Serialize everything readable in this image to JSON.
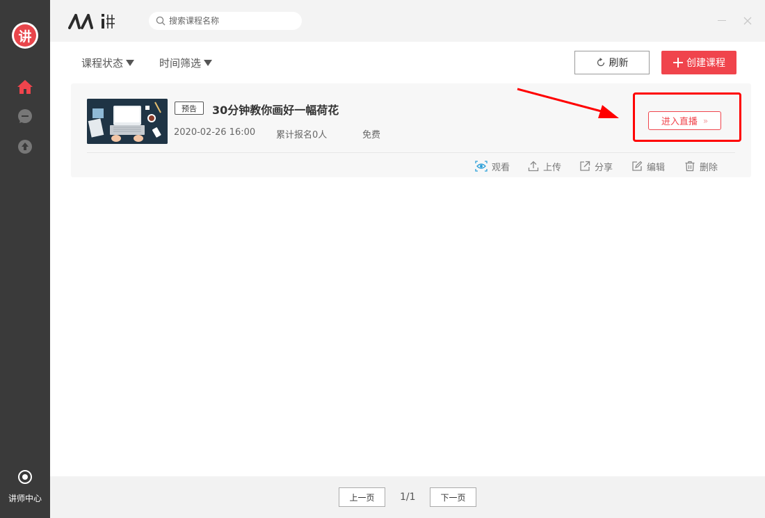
{
  "sidebar": {
    "logo_text": "讲",
    "bottom_label": "讲师中心",
    "active_color": "#f0444c"
  },
  "topbar": {
    "brand": "人人讲",
    "search_placeholder": "搜索课程名称"
  },
  "filters": {
    "status_label": "课程状态",
    "time_label": "时间筛选"
  },
  "toolbar": {
    "refresh_label": "刷新",
    "create_label": "创建课程"
  },
  "course": {
    "tag": "预告",
    "title": "30分钟教你画好一幅荷花",
    "datetime": "2020-02-26 16:00",
    "enrolled": "累计报名0人",
    "price": "免费",
    "live_label": "进入直播",
    "actions": {
      "watch": "观看",
      "upload": "上传",
      "share": "分享",
      "edit": "编辑",
      "delete": "删除"
    }
  },
  "pagination": {
    "prev": "上一页",
    "current": "1/1",
    "next": "下一页"
  },
  "colors": {
    "accent": "#f0444c",
    "sidebar_bg": "#3a3a3a",
    "highlight": "#ff0000"
  }
}
